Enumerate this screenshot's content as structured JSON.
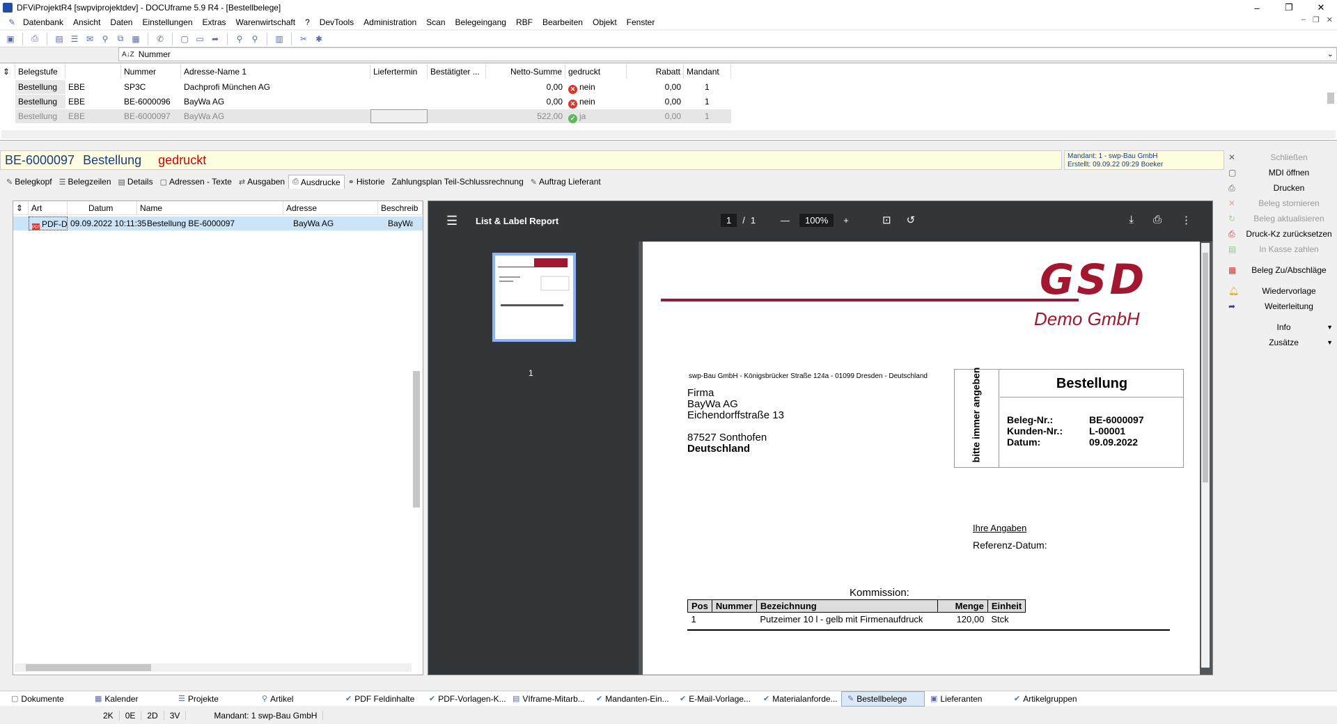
{
  "window": {
    "title": "DFViProjektR4 [swpviprojektdev] - DOCUframe 5.9 R4 - [Bestellbelege]",
    "min": "–",
    "max": "❐",
    "close": "✕"
  },
  "menu": [
    "Datenbank",
    "Ansicht",
    "Daten",
    "Einstellungen",
    "Extras",
    "Warenwirtschaft",
    "?",
    "DevTools",
    "Administration",
    "Scan",
    "Belegeingang",
    "RBF",
    "Bearbeiten",
    "Objekt",
    "Fenster"
  ],
  "sortbar": {
    "az": "A↓Z",
    "field": "Nummer"
  },
  "grid": {
    "headers": [
      "Belegstufe",
      "",
      "Nummer",
      "Adresse-Name 1",
      "Liefertermin",
      "Bestätigter ...",
      "Netto-Summe",
      "gedruckt",
      "Rabatt",
      "Mandant"
    ],
    "rows": [
      {
        "stufe": "Bestellung",
        "kz": "EBE",
        "nummer": "SP3C",
        "adresse": "Dachprofi München AG",
        "liefer": "",
        "best": "",
        "netto": "0,00",
        "gedruckt": "nein",
        "rabatt": "0,00",
        "mandant": "1"
      },
      {
        "stufe": "Bestellung",
        "kz": "EBE",
        "nummer": "BE-6000096",
        "adresse": "BayWa AG",
        "liefer": "",
        "best": "",
        "netto": "0,00",
        "gedruckt": "nein",
        "rabatt": "0,00",
        "mandant": "1"
      },
      {
        "stufe": "Bestellung",
        "kz": "EBE",
        "nummer": "BE-6000097",
        "adresse": "BayWa AG",
        "liefer": "",
        "best": "",
        "netto": "522,00",
        "gedruckt": "ja",
        "rabatt": "0,00",
        "mandant": "1"
      }
    ]
  },
  "doc": {
    "number": "BE-6000097",
    "type": "Bestellung",
    "status": "gedruckt",
    "mandant_label": "Mandant:",
    "mandant": "1 - swp-Bau GmbH",
    "erstellt_label": "Erstellt:",
    "erstellt": "09.09.22 09:29  Boeker"
  },
  "tabs": [
    "Belegkopf",
    "Belegzeilen",
    "Details",
    "Adressen - Texte",
    "Ausgaben",
    "Ausdrucke",
    "Historie",
    "Zahlungsplan Teil-Schlussrechnung",
    "Auftrag Lieferant"
  ],
  "list": {
    "headers": [
      "Art",
      "Datum",
      "Name",
      "Adresse",
      "Beschreib"
    ],
    "row": {
      "art": "PDF-D",
      "datum": "09.09.2022 10:11:35",
      "name": "Bestellung BE-6000097",
      "adresse": "BayWa AG",
      "beschr": "BayWa"
    }
  },
  "viewer": {
    "title": "List & Label Report",
    "page": "1",
    "sep": "/",
    "pages": "1",
    "zoom": "100%",
    "thumb_label": "1"
  },
  "pdf": {
    "logo": "GSD",
    "logo_sub": "Demo GmbH",
    "sender": "swp-Bau GmbH - Königsbrücker Straße 124a - 01099 Dresden - Deutschland",
    "addr1": "Firma",
    "addr2": "BayWa AG",
    "addr3": "Eichendorffstraße 13",
    "addr4": "87527 Sonthofen",
    "addr5": "Deutschland",
    "vert": "bitte immer angeben",
    "box_title": "Bestellung",
    "beleg_label": "Beleg-Nr.:",
    "beleg": "BE-6000097",
    "kunde_label": "Kunden-Nr.:",
    "kunde": "L-00001",
    "datum_label": "Datum:",
    "datum": "09.09.2022",
    "ihre": "Ihre Angaben",
    "ref": "Referenz-Datum:",
    "kommission": "Kommission:",
    "table_headers": [
      "Pos",
      "Nummer",
      "Bezeichnung",
      "Menge",
      "Einheit"
    ],
    "table_row": {
      "pos": "1",
      "nummer": "",
      "bez": "Putzeimer 10 l - gelb mit Firmenaufdruck",
      "menge": "120,00",
      "einheit": "Stck"
    }
  },
  "rpanel": [
    {
      "label": "Schließen",
      "disabled": true,
      "icon": "close-icon"
    },
    {
      "label": "MDI öffnen",
      "disabled": false,
      "icon": "window-icon"
    },
    {
      "label": "Drucken",
      "disabled": false,
      "icon": "printer-icon"
    },
    {
      "label": "Beleg stornieren",
      "disabled": true,
      "icon": "cancel-icon"
    },
    {
      "label": "Beleg aktualisieren",
      "disabled": true,
      "icon": "refresh-icon"
    },
    {
      "label": "Druck-Kz zurücksetzen",
      "disabled": false,
      "icon": "reset-print-icon"
    },
    {
      "label": "In Kasse zahlen",
      "disabled": true,
      "icon": "cash-icon"
    },
    {
      "label": "Beleg Zu/Abschläge",
      "disabled": false,
      "icon": "surcharge-icon"
    },
    {
      "label": "Wiedervorlage",
      "disabled": false,
      "icon": "bell-icon"
    },
    {
      "label": "Weiterleitung",
      "disabled": false,
      "icon": "forward-icon"
    },
    {
      "label": "Info",
      "disabled": false,
      "icon": "",
      "dropdown": true
    },
    {
      "label": "Zusätze",
      "disabled": false,
      "icon": "",
      "dropdown": true
    }
  ],
  "bottomtabs": [
    "Dokumente",
    "Kalender",
    "Projekte",
    "Artikel",
    "PDF Feldinhalte",
    "PDF-Vorlagen-K...",
    "VIframe-Mitarb...",
    "Mandanten-Ein...",
    "E-Mail-Vorlage...",
    "Materialanforde...",
    "Bestellbelege",
    "Lieferanten",
    "Artikelgruppen"
  ],
  "status": [
    "2K",
    "0E",
    "2D",
    "3V",
    "Mandant: 1 swp-Bau GmbH"
  ]
}
